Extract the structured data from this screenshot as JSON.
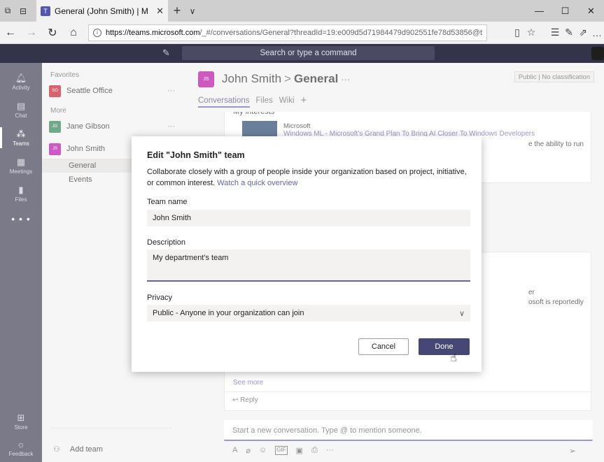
{
  "browser": {
    "tab_title": "General (John Smith) | M",
    "tab_close": "✕",
    "tab_new": "+",
    "tab_dropdown": "∨",
    "url_host": "https://teams.microsoft.com",
    "url_path": "/_#/conversations/General?threadId=19:e009d5d71984479d902551fe78d53856@thread.skype",
    "window_controls": {
      "minimize": "—",
      "maximize": "☐",
      "close": "✕"
    }
  },
  "header": {
    "search_placeholder": "Search or type a command"
  },
  "rail": {
    "items": [
      {
        "label": "Activity",
        "icon": "bell-icon"
      },
      {
        "label": "Chat",
        "icon": "chat-icon"
      },
      {
        "label": "Teams",
        "icon": "teams-icon"
      },
      {
        "label": "Meetings",
        "icon": "calendar-icon"
      },
      {
        "label": "Files",
        "icon": "file-icon"
      }
    ],
    "more": "• • •",
    "bottom": [
      {
        "label": "Store",
        "icon": "store-icon"
      },
      {
        "label": "Feedback",
        "icon": "feedback-icon"
      }
    ]
  },
  "teamlist": {
    "favorites_heading": "Favorites",
    "more_heading": "More",
    "favorites": [
      {
        "name": "Seattle Office",
        "initials": "SO",
        "color": "#c50f1f"
      }
    ],
    "more": [
      {
        "name": "Jane Gibson",
        "initials": "JG",
        "color": "#237b4b"
      },
      {
        "name": "John Smith",
        "initials": "JS",
        "color": "#b4009e"
      }
    ],
    "channels": [
      "General",
      "Events"
    ],
    "team_more": "···",
    "add_team": "Add team"
  },
  "channel": {
    "tile": "JS",
    "team": "John Smith",
    "separator": ">",
    "name": "General",
    "more": "···",
    "classification": "Public | No classification",
    "tabs": [
      "Conversations",
      "Files",
      "Wiki"
    ],
    "add_tab": "+"
  },
  "feed": {
    "card1_heading": "My interests",
    "card1_source": "Microsoft",
    "card1_link": "Windows ML - Microsoft's Grand Plan To Bring AI Closer To Windows Developers",
    "card1_snippet": "e the ability to run",
    "card2_line1": "er",
    "card2_line2": "osoft is reportedly",
    "see_more": "See more",
    "reply": "↩ Reply",
    "compose_placeholder": "Start a new conversation. Type @ to mention someone.",
    "compose_tools": [
      "A",
      "⌀",
      "☺",
      "GIF",
      "▣",
      "⎙",
      "···"
    ],
    "send": "➢"
  },
  "modal": {
    "title": "Edit \"John Smith\" team",
    "description": "Collaborate closely with a group of people inside your organization based on project, initiative, or common interest.",
    "description_link": "Watch a quick overview",
    "team_name_label": "Team name",
    "team_name_value": "John Smith",
    "description_label": "Description",
    "description_value": "My department's team",
    "privacy_label": "Privacy",
    "privacy_value": "Public - Anyone in your organization can join",
    "cancel_label": "Cancel",
    "done_label": "Done"
  },
  "colors": {
    "brand": "#6264a7",
    "header_bg": "#33344a",
    "done_button": "#464775"
  }
}
